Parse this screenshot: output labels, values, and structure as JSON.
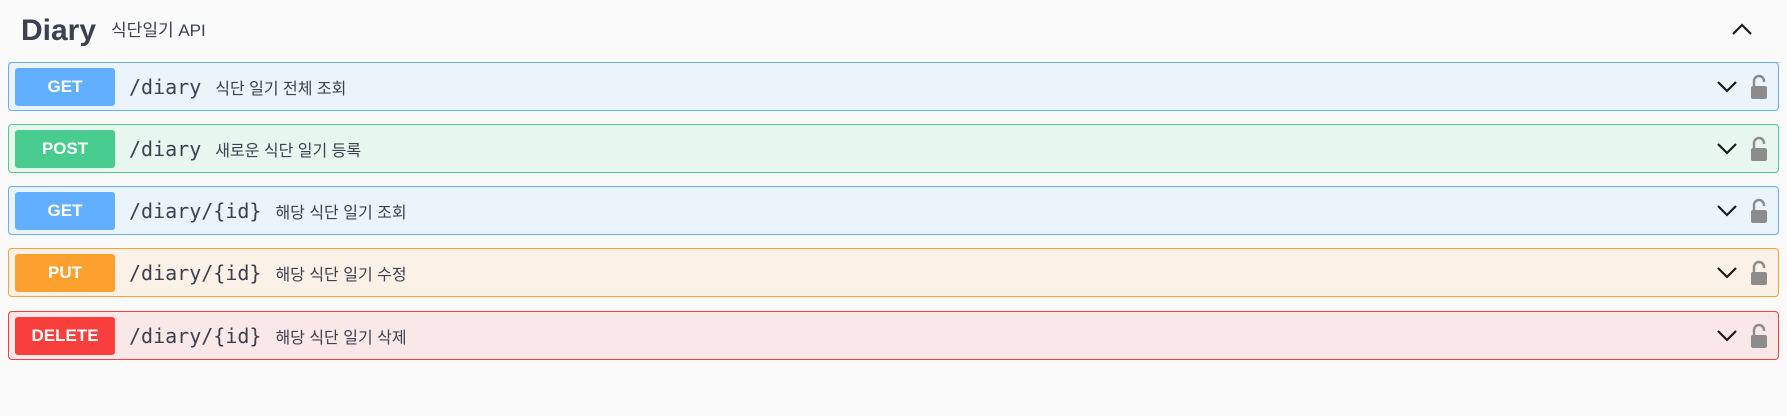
{
  "tag": {
    "name": "Diary",
    "description": "식단일기 API",
    "toggle_icon": "chevron-up-icon"
  },
  "operations": [
    {
      "method": "GET",
      "path": "/diary",
      "summary": "식단 일기 전체 조회",
      "color": "#61affe"
    },
    {
      "method": "POST",
      "path": "/diary",
      "summary": "새로운 식단 일기 등록",
      "color": "#49cc90"
    },
    {
      "method": "GET",
      "path": "/diary/{id}",
      "summary": "해당 식단 일기 조회",
      "color": "#61affe"
    },
    {
      "method": "PUT",
      "path": "/diary/{id}",
      "summary": "해당 식단 일기 수정",
      "color": "#fca130"
    },
    {
      "method": "DELETE",
      "path": "/diary/{id}",
      "summary": "해당 식단 일기 삭제",
      "color": "#f93e3e"
    }
  ],
  "icons": {
    "expand": "chevron-down-icon",
    "auth": "lock-icon"
  }
}
